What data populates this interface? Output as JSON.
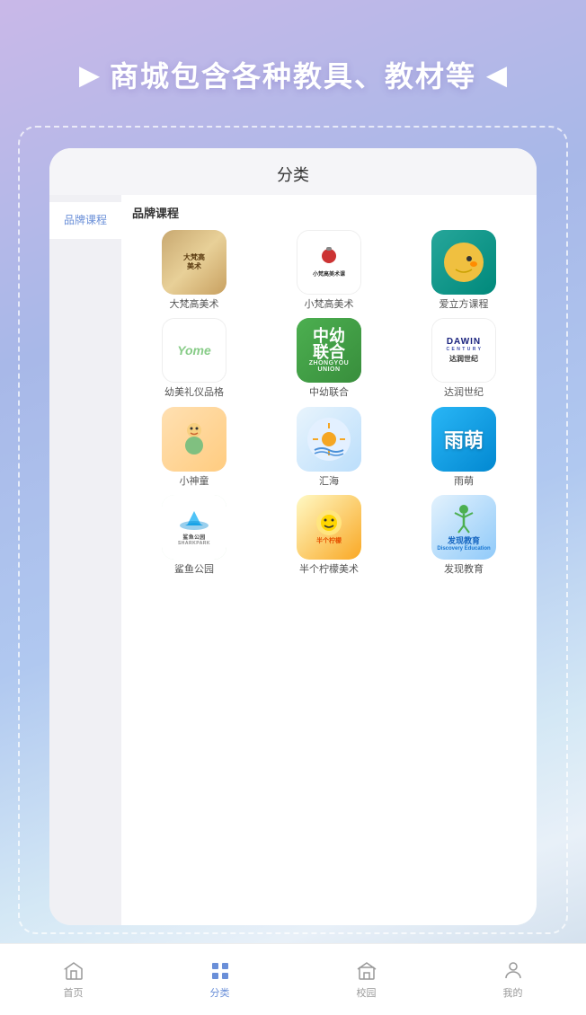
{
  "app": {
    "title": "分类"
  },
  "header": {
    "banner_text": "商城包含各种教具、教材等",
    "arrow_left": "▶",
    "arrow_right": "◀"
  },
  "sidebar": {
    "items": [
      {
        "id": "brand-course",
        "label": "品牌课程",
        "active": true
      }
    ]
  },
  "content": {
    "section_title": "品牌课程",
    "brands": [
      {
        "id": "dafan",
        "name": "大梵高美术",
        "logo_text": "大梵高美术"
      },
      {
        "id": "xiaofan",
        "name": "小梵高美术",
        "logo_text": "小梵高美术课"
      },
      {
        "id": "ailifang",
        "name": "爱立方课程",
        "logo_text": ""
      },
      {
        "id": "youmei",
        "name": "幼美礼仪品格",
        "logo_text": "Yome"
      },
      {
        "id": "zhongyou",
        "name": "中幼联合",
        "logo_text": "中幼联合"
      },
      {
        "id": "darun",
        "name": "达润世纪",
        "logo_text": "DAWIN"
      },
      {
        "id": "xiaoshentong",
        "name": "小神童",
        "logo_text": ""
      },
      {
        "id": "huihai",
        "name": "汇海",
        "logo_text": ""
      },
      {
        "id": "yumeng",
        "name": "雨萌",
        "logo_text": "雨萌"
      },
      {
        "id": "sharkpark",
        "name": "鲨鱼公园",
        "logo_text": "SHARKPARK"
      },
      {
        "id": "banlemon",
        "name": "半个柠檬美术",
        "logo_text": ""
      },
      {
        "id": "faxian",
        "name": "发现教育",
        "logo_text": "Discovery Education"
      }
    ]
  },
  "bottom_nav": {
    "items": [
      {
        "id": "home",
        "label": "首页",
        "icon": "home",
        "active": false
      },
      {
        "id": "category",
        "label": "分类",
        "icon": "category",
        "active": true
      },
      {
        "id": "campus",
        "label": "校园",
        "icon": "campus",
        "active": false
      },
      {
        "id": "mine",
        "label": "我的",
        "icon": "mine",
        "active": false
      }
    ]
  }
}
